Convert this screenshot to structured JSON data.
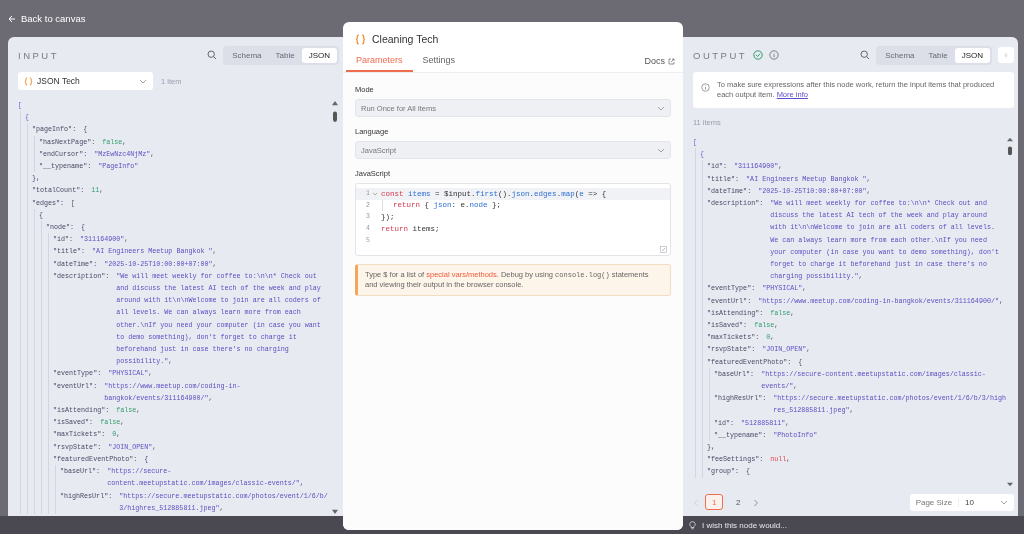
{
  "top_bar": {
    "back_link": "Back to canvas"
  },
  "input_panel": {
    "title": "INPUT",
    "views": [
      {
        "label": "Schema",
        "selected": false
      },
      {
        "label": "Table",
        "selected": false
      },
      {
        "label": "JSON",
        "selected": true
      }
    ],
    "source": {
      "value": "JSON Tech"
    },
    "item_count": "1 item",
    "lines": [
      {
        "tokens": [
          {
            "kind": "bracket",
            "text": "["
          }
        ],
        "children": [
          {
            "tokens": [
              {
                "kind": "bracket",
                "text": "{"
              }
            ],
            "children": [
              {
                "tokens": [
                  {
                    "kind": "key",
                    "text": "\"pageInfo\":"
                  },
                  {
                    "kind": "punct",
                    "text": "{"
                  }
                ],
                "children": [
                  {
                    "tokens": [
                      {
                        "kind": "key",
                        "text": "\"hasNextPage\":"
                      },
                      {
                        "kind": "boolean",
                        "text": "false"
                      },
                      {
                        "kind": "punct",
                        "text": ","
                      }
                    ]
                  },
                  {
                    "tokens": [
                      {
                        "kind": "key",
                        "text": "\"endCursor\":"
                      },
                      {
                        "kind": "string",
                        "text": "\"MzEwNzc4NjMz\""
                      },
                      {
                        "kind": "punct",
                        "text": ","
                      }
                    ]
                  },
                  {
                    "tokens": [
                      {
                        "kind": "key",
                        "text": "\"__typename\":"
                      },
                      {
                        "kind": "string",
                        "text": "\"PageInfo\""
                      }
                    ]
                  }
                ]
              },
              {
                "tokens": [
                  {
                    "kind": "punct",
                    "text": "},"
                  }
                ]
              },
              {
                "tokens": [
                  {
                    "kind": "key",
                    "text": "\"totalCount\":"
                  },
                  {
                    "kind": "number",
                    "text": "11"
                  },
                  {
                    "kind": "punct",
                    "text": ","
                  }
                ]
              },
              {
                "tokens": [
                  {
                    "kind": "key",
                    "text": "\"edges\":"
                  },
                  {
                    "kind": "punct",
                    "text": "["
                  }
                ],
                "children": [
                  {
                    "tokens": [
                      {
                        "kind": "punct",
                        "text": "{"
                      }
                    ],
                    "children": [
                      {
                        "tokens": [
                          {
                            "kind": "key",
                            "text": "\"node\":"
                          },
                          {
                            "kind": "punct",
                            "text": "{"
                          }
                        ],
                        "children": [
                          {
                            "tokens": [
                              {
                                "kind": "key",
                                "text": "\"id\":"
                              },
                              {
                                "kind": "string",
                                "text": "\"311164900\""
                              },
                              {
                                "kind": "punct",
                                "text": ","
                              }
                            ]
                          },
                          {
                            "tokens": [
                              {
                                "kind": "key",
                                "text": "\"title\":"
                              },
                              {
                                "kind": "string",
                                "text": "\"AI Engineers Meetup Bangkok \""
                              },
                              {
                                "kind": "punct",
                                "text": ","
                              }
                            ]
                          },
                          {
                            "tokens": [
                              {
                                "kind": "key",
                                "text": "\"dateTime\":"
                              },
                              {
                                "kind": "string",
                                "text": "\"2025-10-25T10:00:00+07:00\""
                              },
                              {
                                "kind": "punct",
                                "text": ","
                              }
                            ]
                          },
                          {
                            "tokens": [
                              {
                                "kind": "key",
                                "text": "\"description\":"
                              },
                              {
                                "kind": "string",
                                "text": "\"We will meet weekly for coffee to:\\n\\n* Check out and discuss the latest AI tech of the week and play around with it\\n\\nWelcome to join are all coders of all levels. We can always learn more from each other.\\nIf you need your computer (in case you want to demo something), don't forget to charge it beforehand just in case there's no charging possibility.\""
                              },
                              {
                                "kind": "punct",
                                "text": ","
                              }
                            ]
                          },
                          {
                            "tokens": [
                              {
                                "kind": "key",
                                "text": "\"eventType\":"
                              },
                              {
                                "kind": "string",
                                "text": "\"PHYSICAL\""
                              },
                              {
                                "kind": "punct",
                                "text": ","
                              }
                            ]
                          },
                          {
                            "tokens": [
                              {
                                "kind": "key",
                                "text": "\"eventUrl\":"
                              },
                              {
                                "kind": "string",
                                "text": "\"https://www.meetup.com/coding-in-bangkok/events/311164900/\""
                              },
                              {
                                "kind": "punct",
                                "text": ","
                              }
                            ]
                          },
                          {
                            "tokens": [
                              {
                                "kind": "key",
                                "text": "\"isAttending\":"
                              },
                              {
                                "kind": "boolean",
                                "text": "false"
                              },
                              {
                                "kind": "punct",
                                "text": ","
                              }
                            ]
                          },
                          {
                            "tokens": [
                              {
                                "kind": "key",
                                "text": "\"isSaved\":"
                              },
                              {
                                "kind": "boolean",
                                "text": "false"
                              },
                              {
                                "kind": "punct",
                                "text": ","
                              }
                            ]
                          },
                          {
                            "tokens": [
                              {
                                "kind": "key",
                                "text": "\"maxTickets\":"
                              },
                              {
                                "kind": "number",
                                "text": "0"
                              },
                              {
                                "kind": "punct",
                                "text": ","
                              }
                            ]
                          },
                          {
                            "tokens": [
                              {
                                "kind": "key",
                                "text": "\"rsvpState\":"
                              },
                              {
                                "kind": "string",
                                "text": "\"JOIN_OPEN\""
                              },
                              {
                                "kind": "punct",
                                "text": ","
                              }
                            ]
                          },
                          {
                            "tokens": [
                              {
                                "kind": "key",
                                "text": "\"featuredEventPhoto\":"
                              },
                              {
                                "kind": "punct",
                                "text": "{"
                              }
                            ],
                            "children": [
                              {
                                "tokens": [
                                  {
                                    "kind": "key",
                                    "text": "\"baseUrl\":"
                                  },
                                  {
                                    "kind": "string",
                                    "text": "\"https://secure-content.meetupstatic.com/images/classic-events/\""
                                  },
                                  {
                                    "kind": "punct",
                                    "text": ","
                                  }
                                ]
                              },
                              {
                                "tokens": [
                                  {
                                    "kind": "key",
                                    "text": "\"highResUrl\":"
                                  },
                                  {
                                    "kind": "string",
                                    "text": "\"https://secure.meetupstatic.com/photos/event/1/6/b/3/highres_512885811.jpeg\""
                                  },
                                  {
                                    "kind": "punct",
                                    "text": ","
                                  }
                                ]
                              }
                            ]
                          }
                        ]
                      }
                    ]
                  }
                ]
              }
            ]
          }
        ]
      }
    ]
  },
  "editor": {
    "title": "Cleaning Tech",
    "tabs": [
      {
        "label": "Parameters",
        "selected": true
      },
      {
        "label": "Settings",
        "selected": false
      }
    ],
    "docs_link": "Docs",
    "fields": [
      {
        "label": "Mode",
        "value": "Run Once for All Items"
      },
      {
        "label": "Language",
        "value": "JavaScript"
      }
    ],
    "code_label": "JavaScript",
    "code": [
      {
        "number": "1",
        "foldable": true,
        "indented": false,
        "tokens": [
          {
            "kind": "keyword",
            "text": "const "
          },
          {
            "kind": "name",
            "text": "items"
          },
          {
            "kind": "plain",
            "text": " = $input."
          },
          {
            "kind": "name",
            "text": "first"
          },
          {
            "kind": "plain",
            "text": "()."
          },
          {
            "kind": "name",
            "text": "json"
          },
          {
            "kind": "plain",
            "text": "."
          },
          {
            "kind": "name",
            "text": "edges"
          },
          {
            "kind": "plain",
            "text": "."
          },
          {
            "kind": "name",
            "text": "map"
          },
          {
            "kind": "plain",
            "text": "("
          },
          {
            "kind": "name",
            "text": "e"
          },
          {
            "kind": "plain",
            "text": " => {"
          }
        ]
      },
      {
        "number": "2",
        "foldable": false,
        "indented": true,
        "tokens": [
          {
            "kind": "keyword",
            "text": "return"
          },
          {
            "kind": "plain",
            "text": " { "
          },
          {
            "kind": "name",
            "text": "json"
          },
          {
            "kind": "plain",
            "text": ": e."
          },
          {
            "kind": "name",
            "text": "node"
          },
          {
            "kind": "plain",
            "text": " };"
          }
        ]
      },
      {
        "number": "3",
        "foldable": false,
        "indented": false,
        "tokens": [
          {
            "kind": "plain",
            "text": "});"
          }
        ]
      },
      {
        "number": "4",
        "foldable": false,
        "indented": false,
        "tokens": [
          {
            "kind": "keyword",
            "text": "return"
          },
          {
            "kind": "plain",
            "text": " items;"
          }
        ]
      },
      {
        "number": "5",
        "foldable": false,
        "indented": false
      }
    ],
    "hint": [
      {
        "kind": "text",
        "text": "Type $ for a list of "
      },
      {
        "kind": "link",
        "text": "special vars/methods"
      },
      {
        "kind": "text",
        "text": ". Debug by using "
      },
      {
        "kind": "code",
        "text": "console.log()"
      },
      {
        "kind": "text",
        "text": " statements and viewing their output in the browser console."
      }
    ]
  },
  "output_panel": {
    "title": "OUTPUT",
    "views": [
      {
        "label": "Schema",
        "selected": false
      },
      {
        "label": "Table",
        "selected": false
      },
      {
        "label": "JSON",
        "selected": true
      }
    ],
    "notice": {
      "text": "To make sure expressions after this node work, return the input items that produced each output item. ",
      "link": "More info"
    },
    "item_count": "11 items",
    "lines": [
      {
        "tokens": [
          {
            "kind": "bracket",
            "text": "["
          }
        ],
        "children": [
          {
            "tokens": [
              {
                "kind": "bracket",
                "text": "{"
              }
            ],
            "children": [
              {
                "tokens": [
                  {
                    "kind": "key",
                    "text": "\"id\":"
                  },
                  {
                    "kind": "string",
                    "text": "\"311164900\""
                  },
                  {
                    "kind": "punct",
                    "text": ","
                  }
                ]
              },
              {
                "tokens": [
                  {
                    "kind": "key",
                    "text": "\"title\":"
                  },
                  {
                    "kind": "string",
                    "text": "\"AI Engineers Meetup Bangkok \""
                  },
                  {
                    "kind": "punct",
                    "text": ","
                  }
                ]
              },
              {
                "tokens": [
                  {
                    "kind": "key",
                    "text": "\"dateTime\":"
                  },
                  {
                    "kind": "string",
                    "text": "\"2025-10-25T10:00:00+07:00\""
                  },
                  {
                    "kind": "punct",
                    "text": ","
                  }
                ]
              },
              {
                "tokens": [
                  {
                    "kind": "key",
                    "text": "\"description\":"
                  },
                  {
                    "kind": "string",
                    "text": "\"We will meet weekly for coffee to:\\n\\n* Check out and discuss the latest AI tech of the week and play around with it\\n\\nWelcome to join are all coders of all levels. We can always learn more from each other.\\nIf you need your computer (in case you want to demo something), don't forget to charge it beforehand just in case there's no charging possibility.\""
                  },
                  {
                    "kind": "punct",
                    "text": ","
                  }
                ]
              },
              {
                "tokens": [
                  {
                    "kind": "key",
                    "text": "\"eventType\":"
                  },
                  {
                    "kind": "string",
                    "text": "\"PHYSICAL\""
                  },
                  {
                    "kind": "punct",
                    "text": ","
                  }
                ]
              },
              {
                "tokens": [
                  {
                    "kind": "key",
                    "text": "\"eventUrl\":"
                  },
                  {
                    "kind": "string",
                    "text": "\"https://www.meetup.com/coding-in-bangkok/events/311164900/\""
                  },
                  {
                    "kind": "punct",
                    "text": ","
                  }
                ]
              },
              {
                "tokens": [
                  {
                    "kind": "key",
                    "text": "\"isAttending\":"
                  },
                  {
                    "kind": "boolean",
                    "text": "false"
                  },
                  {
                    "kind": "punct",
                    "text": ","
                  }
                ]
              },
              {
                "tokens": [
                  {
                    "kind": "key",
                    "text": "\"isSaved\":"
                  },
                  {
                    "kind": "boolean",
                    "text": "false"
                  },
                  {
                    "kind": "punct",
                    "text": ","
                  }
                ]
              },
              {
                "tokens": [
                  {
                    "kind": "key",
                    "text": "\"maxTickets\":"
                  },
                  {
                    "kind": "number",
                    "text": "0"
                  },
                  {
                    "kind": "punct",
                    "text": ","
                  }
                ]
              },
              {
                "tokens": [
                  {
                    "kind": "key",
                    "text": "\"rsvpState\":"
                  },
                  {
                    "kind": "string",
                    "text": "\"JOIN_OPEN\""
                  },
                  {
                    "kind": "punct",
                    "text": ","
                  }
                ]
              },
              {
                "tokens": [
                  {
                    "kind": "key",
                    "text": "\"featuredEventPhoto\":"
                  },
                  {
                    "kind": "punct",
                    "text": "{"
                  }
                ],
                "children": [
                  {
                    "tokens": [
                      {
                        "kind": "key",
                        "text": "\"baseUrl\":"
                      },
                      {
                        "kind": "string",
                        "text": "\"https://secure-content.meetupstatic.com/images/classic-events/\""
                      },
                      {
                        "kind": "punct",
                        "text": ","
                      }
                    ]
                  },
                  {
                    "tokens": [
                      {
                        "kind": "key",
                        "text": "\"highResUrl\":"
                      },
                      {
                        "kind": "string",
                        "text": "\"https://secure.meetupstatic.com/photos/event/1/6/b/3/highres_512885811.jpeg\""
                      },
                      {
                        "kind": "punct",
                        "text": ","
                      }
                    ]
                  },
                  {
                    "tokens": [
                      {
                        "kind": "key",
                        "text": "\"id\":"
                      },
                      {
                        "kind": "string",
                        "text": "\"512885811\""
                      },
                      {
                        "kind": "punct",
                        "text": ","
                      }
                    ]
                  },
                  {
                    "tokens": [
                      {
                        "kind": "key",
                        "text": "\"__typename\":"
                      },
                      {
                        "kind": "string",
                        "text": "\"PhotoInfo\""
                      }
                    ]
                  }
                ]
              },
              {
                "tokens": [
                  {
                    "kind": "punct",
                    "text": "},"
                  }
                ]
              },
              {
                "tokens": [
                  {
                    "kind": "key",
                    "text": "\"feeSettings\":"
                  },
                  {
                    "kind": "null",
                    "text": "null"
                  },
                  {
                    "kind": "punct",
                    "text": ","
                  }
                ]
              },
              {
                "tokens": [
                  {
                    "kind": "key",
                    "text": "\"group\":"
                  },
                  {
                    "kind": "punct",
                    "text": "{"
                  }
                ]
              }
            ]
          }
        ]
      }
    ],
    "pagination": {
      "prev_disabled": true,
      "next_disabled": false,
      "pages": [
        {
          "label": "1",
          "selected": true
        },
        {
          "label": "2",
          "selected": false
        }
      ],
      "page_size_label": "Page Size",
      "page_size": "10"
    }
  },
  "feedback_bar": {
    "text": "I wish this node would..."
  }
}
